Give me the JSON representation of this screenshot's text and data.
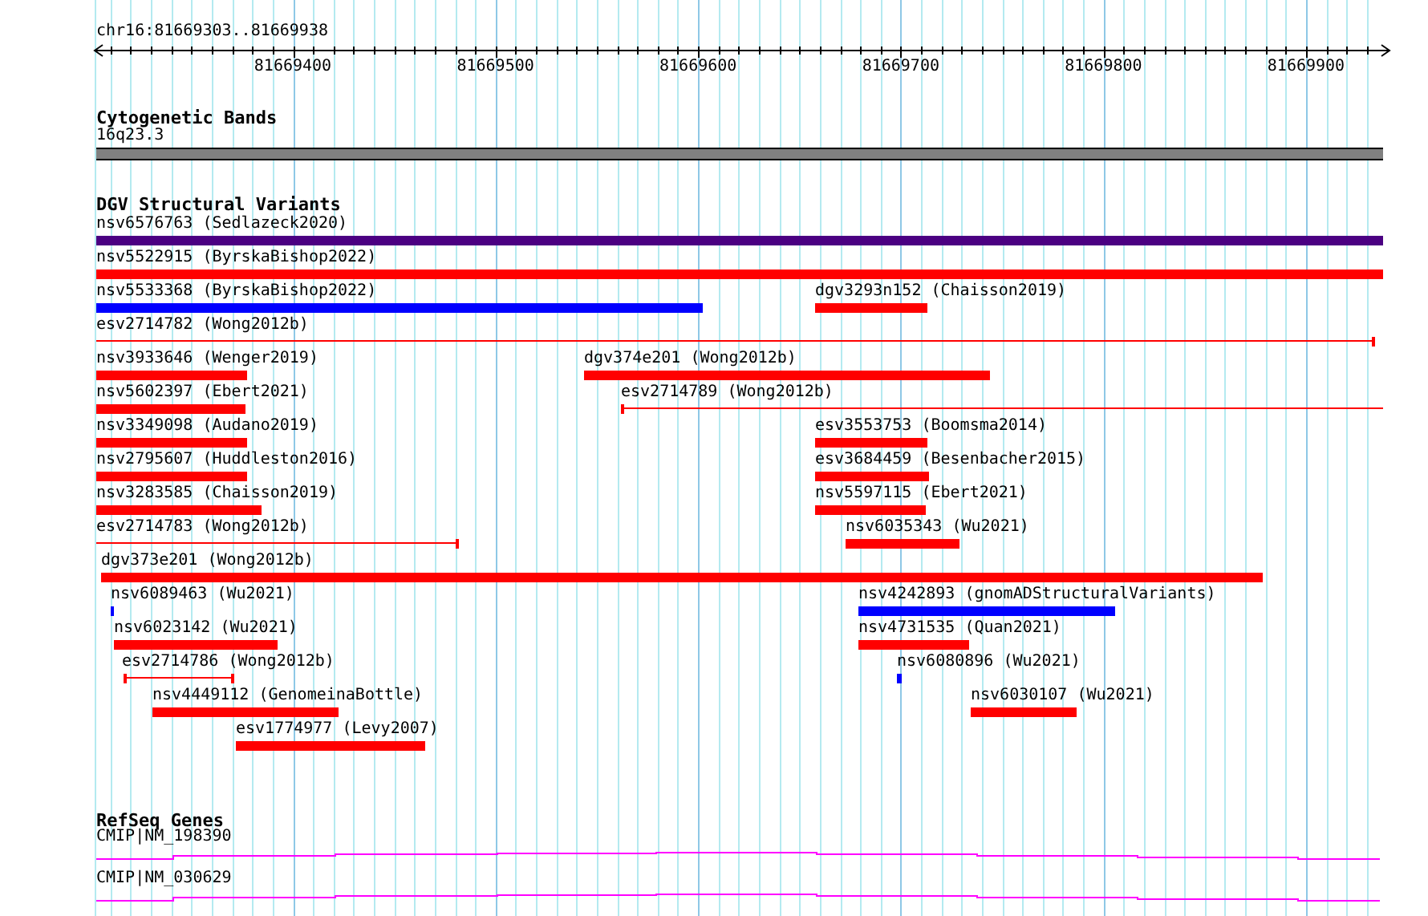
{
  "location": "chr16:81669303..81669938",
  "ruler": {
    "labels": [
      "81669400",
      "81669500",
      "81669600",
      "81669700",
      "81669800",
      "81669900"
    ]
  },
  "tracks": [
    {
      "title": "Cytogenetic Bands",
      "kind": "bands",
      "features": [
        {
          "label": "16q23.3"
        }
      ]
    },
    {
      "title": "DGV Structural Variants",
      "kind": "variants",
      "features": [
        {
          "label": "nsv6576763 (Sedlazeck2020)",
          "kind": "bar",
          "color": "#4b0082"
        },
        {
          "label": "nsv5522915 (ByrskaBishop2022)",
          "kind": "bar",
          "color": "#ff0000"
        },
        {
          "label": "nsv5533368 (ByrskaBishop2022)",
          "kind": "bar",
          "color": "#0000ff"
        },
        {
          "label": "dgv3293n152 (Chaisson2019)",
          "kind": "bar",
          "color": "#ff0000"
        },
        {
          "label": "esv2714782 (Wong2012b)",
          "kind": "line",
          "color": "#ff0000"
        },
        {
          "label": "nsv3933646 (Wenger2019)",
          "kind": "bar",
          "color": "#ff0000"
        },
        {
          "label": "dgv374e201 (Wong2012b)",
          "kind": "bar",
          "color": "#ff0000"
        },
        {
          "label": "nsv5602397 (Ebert2021)",
          "kind": "bar",
          "color": "#ff0000"
        },
        {
          "label": "esv2714789 (Wong2012b)",
          "kind": "line",
          "color": "#ff0000"
        },
        {
          "label": "nsv3349098 (Audano2019)",
          "kind": "bar",
          "color": "#ff0000"
        },
        {
          "label": "esv3553753 (Boomsma2014)",
          "kind": "bar",
          "color": "#ff0000"
        },
        {
          "label": "nsv2795607 (Huddleston2016)",
          "kind": "bar",
          "color": "#ff0000"
        },
        {
          "label": "esv3684459 (Besenbacher2015)",
          "kind": "bar",
          "color": "#ff0000"
        },
        {
          "label": "nsv3283585 (Chaisson2019)",
          "kind": "bar",
          "color": "#ff0000"
        },
        {
          "label": "nsv5597115 (Ebert2021)",
          "kind": "bar",
          "color": "#ff0000"
        },
        {
          "label": "esv2714783 (Wong2012b)",
          "kind": "line",
          "color": "#ff0000"
        },
        {
          "label": "nsv6035343 (Wu2021)",
          "kind": "bar",
          "color": "#ff0000"
        },
        {
          "label": "dgv373e201 (Wong2012b)",
          "kind": "bar",
          "color": "#ff0000"
        },
        {
          "label": "nsv6089463 (Wu2021)",
          "kind": "bar",
          "color": "#0000ff"
        },
        {
          "label": "nsv4242893 (gnomADStructuralVariants)",
          "kind": "bar",
          "color": "#0000ff"
        },
        {
          "label": "nsv6023142 (Wu2021)",
          "kind": "bar",
          "color": "#ff0000"
        },
        {
          "label": "nsv4731535 (Quan2021)",
          "kind": "bar",
          "color": "#ff0000"
        },
        {
          "label": "esv2714786 (Wong2012b)",
          "kind": "line",
          "color": "#ff0000"
        },
        {
          "label": "nsv6080896 (Wu2021)",
          "kind": "bar",
          "color": "#0000ff"
        },
        {
          "label": "nsv4449112 (GenomeinaBottle)",
          "kind": "bar",
          "color": "#ff0000"
        },
        {
          "label": "nsv6030107 (Wu2021)",
          "kind": "bar",
          "color": "#ff0000"
        },
        {
          "label": "esv1774977 (Levy2007)",
          "kind": "bar",
          "color": "#ff0000"
        }
      ]
    },
    {
      "title": "RefSeq Genes",
      "kind": "genes",
      "features": [
        {
          "label": "CMIP|NM_198390"
        },
        {
          "label": "CMIP|NM_030629"
        }
      ]
    }
  ]
}
